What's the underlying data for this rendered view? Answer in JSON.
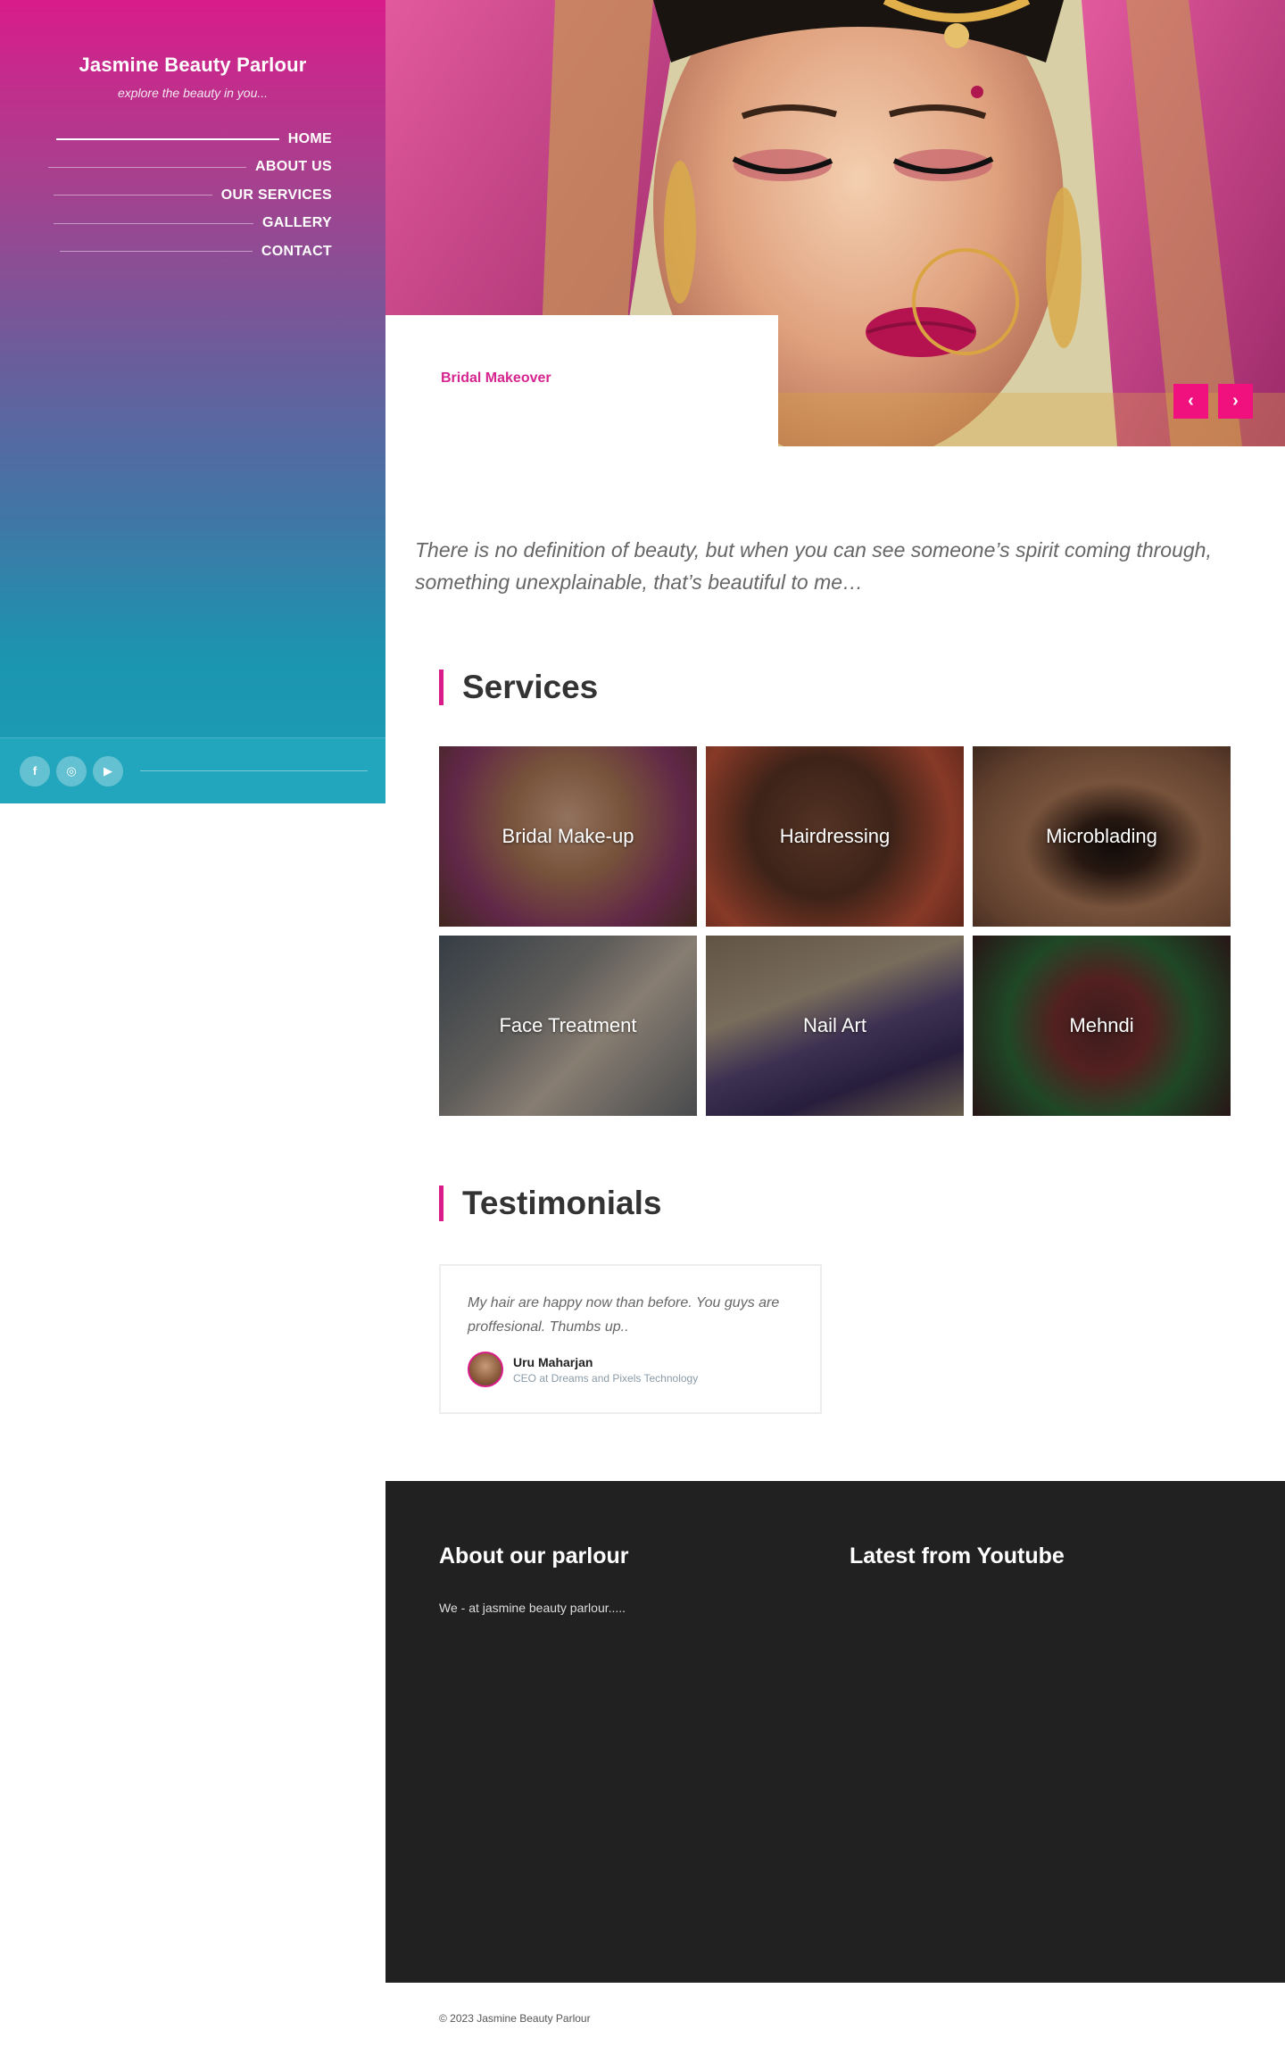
{
  "sidebar": {
    "title": "Jasmine Beauty Parlour",
    "tagline": "explore the beauty in you...",
    "nav": [
      {
        "label": "HOME",
        "active": true
      },
      {
        "label": "ABOUT US",
        "active": false
      },
      {
        "label": "OUR SERVICES",
        "active": false
      },
      {
        "label": "GALLERY",
        "active": false
      },
      {
        "label": "CONTACT",
        "active": false
      }
    ],
    "social": [
      {
        "icon": "facebook-icon",
        "glyph": "f"
      },
      {
        "icon": "instagram-icon",
        "glyph": "◎"
      },
      {
        "icon": "youtube-icon",
        "glyph": "▶"
      }
    ]
  },
  "hero": {
    "caption": "Bridal Makeover",
    "prev_glyph": "‹",
    "next_glyph": "›"
  },
  "quote": "There is no definition of beauty, but when you can see someone’s spirit coming through, something unexplainable, that’s beautiful to me…",
  "services": {
    "heading": "Services",
    "items": [
      "Bridal Make-up",
      "Hairdressing",
      "Microblading",
      "Face Treatment",
      "Nail Art",
      "Mehndi"
    ]
  },
  "testimonials": {
    "heading": "Testimonials",
    "items": [
      {
        "text": "My hair are happy now than before. You guys are proffesional. Thumbs up..",
        "author": "Uru Maharjan",
        "role": "CEO at Dreams and Pixels Technology"
      }
    ]
  },
  "footer": {
    "about_heading": "About our parlour",
    "about_text": "We - at jasmine beauty parlour.....",
    "youtube_heading": "Latest from Youtube",
    "copyright": "© 2023 Jasmine Beauty Parlour"
  },
  "colors": {
    "accent": "#d91c8a",
    "button": "#f0117f",
    "footer_bg": "#212121",
    "social_bar": "#22a6bd"
  }
}
